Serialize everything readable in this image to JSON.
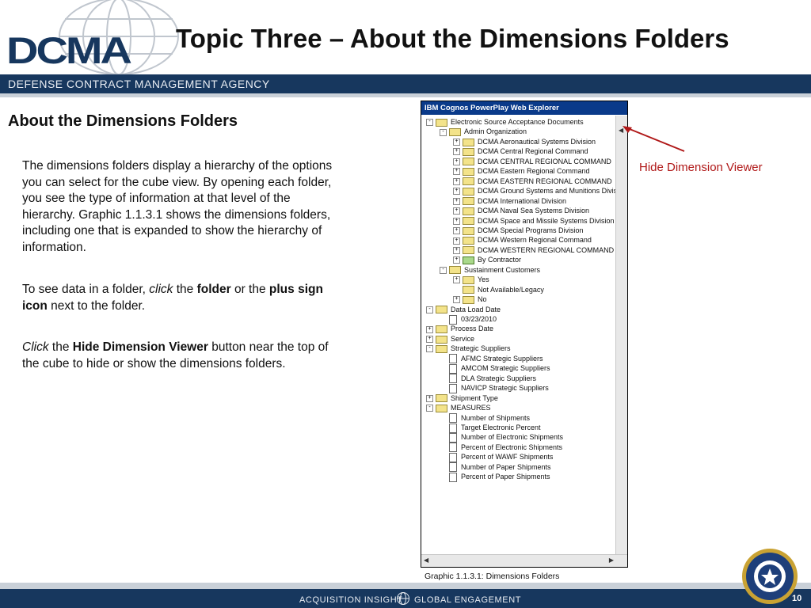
{
  "logo": {
    "text": "DCMA"
  },
  "title": "Topic Three – About the Dimensions Folders",
  "agency": "DEFENSE CONTRACT MANAGEMENT AGENCY",
  "subtitle": "About the Dimensions Folders",
  "para1": "The dimensions folders display a hierarchy of the options you can select for the cube view. By opening each folder, you see the type of information at that level of the hierarchy. Graphic 1.1.3.1 shows the dimensions folders, including one that is expanded to show the hierarchy of information.",
  "para2": {
    "a": "To see data in a folder, ",
    "b": "click",
    "c": " the ",
    "d": "folder",
    "e": " or the ",
    "f": "plus sign icon",
    "g": " next to the folder."
  },
  "para3": {
    "a": "Click",
    "b": " the ",
    "c": "Hide Dimension Viewer",
    "d": " button near the top of the cube to hide or show the dimensions folders."
  },
  "screenshot": {
    "title": "IBM Cognos PowerPlay Web Explorer",
    "tree": [
      {
        "label": "Electronic Source Acceptance Documents",
        "level": 0,
        "expander": "-",
        "icon": "folder"
      },
      {
        "label": "Admin Organization",
        "level": 1,
        "expander": "-",
        "icon": "folder"
      },
      {
        "label": "DCMA Aeronautical Systems Division",
        "level": 2,
        "expander": "+",
        "icon": "folder"
      },
      {
        "label": "DCMA Central Regional Command",
        "level": 2,
        "expander": "+",
        "icon": "folder"
      },
      {
        "label": "DCMA CENTRAL REGIONAL COMMAND",
        "level": 2,
        "expander": "+",
        "icon": "folder"
      },
      {
        "label": "DCMA Eastern Regional Command",
        "level": 2,
        "expander": "+",
        "icon": "folder"
      },
      {
        "label": "DCMA EASTERN REGIONAL COMMAND",
        "level": 2,
        "expander": "+",
        "icon": "folder"
      },
      {
        "label": "DCMA Ground Systems and Munitions Divis",
        "level": 2,
        "expander": "+",
        "icon": "folder"
      },
      {
        "label": "DCMA International Division",
        "level": 2,
        "expander": "+",
        "icon": "folder"
      },
      {
        "label": "DCMA Naval Sea Systems Division",
        "level": 2,
        "expander": "+",
        "icon": "folder"
      },
      {
        "label": "DCMA Space and Missile Systems Division",
        "level": 2,
        "expander": "+",
        "icon": "folder"
      },
      {
        "label": "DCMA Special Programs Division",
        "level": 2,
        "expander": "+",
        "icon": "folder"
      },
      {
        "label": "DCMA Western Regional Command",
        "level": 2,
        "expander": "+",
        "icon": "folder"
      },
      {
        "label": "DCMA WESTERN REGIONAL COMMAND",
        "level": 2,
        "expander": "+",
        "icon": "folder"
      },
      {
        "label": "By Contractor",
        "level": 2,
        "expander": "+",
        "icon": "folder-green"
      },
      {
        "label": "Sustainment Customers",
        "level": 1,
        "expander": "-",
        "icon": "folder"
      },
      {
        "label": "Yes",
        "level": 2,
        "expander": "+",
        "icon": "folder"
      },
      {
        "label": "Not Available/Legacy",
        "level": 2,
        "expander": "",
        "icon": "folder"
      },
      {
        "label": "No",
        "level": 2,
        "expander": "+",
        "icon": "folder"
      },
      {
        "label": "Data Load Date",
        "level": 0,
        "expander": "-",
        "icon": "folder"
      },
      {
        "label": "03/23/2010",
        "level": 1,
        "expander": "",
        "icon": "page"
      },
      {
        "label": "Process Date",
        "level": 0,
        "expander": "+",
        "icon": "folder"
      },
      {
        "label": "Service",
        "level": 0,
        "expander": "+",
        "icon": "folder"
      },
      {
        "label": "Strategic Suppliers",
        "level": 0,
        "expander": "-",
        "icon": "folder"
      },
      {
        "label": "AFMC Strategic Suppliers",
        "level": 1,
        "expander": "",
        "icon": "page"
      },
      {
        "label": "AMCOM Strategic Suppliers",
        "level": 1,
        "expander": "",
        "icon": "page"
      },
      {
        "label": "DLA Strategic Suppliers",
        "level": 1,
        "expander": "",
        "icon": "page"
      },
      {
        "label": "NAVICP Strategic Suppliers",
        "level": 1,
        "expander": "",
        "icon": "page"
      },
      {
        "label": "Shipment Type",
        "level": 0,
        "expander": "+",
        "icon": "folder"
      },
      {
        "label": "MEASURES",
        "level": 0,
        "expander": "-",
        "icon": "folder"
      },
      {
        "label": "Number of Shipments",
        "level": 1,
        "expander": "",
        "icon": "page"
      },
      {
        "label": "Target Electronic Percent",
        "level": 1,
        "expander": "",
        "icon": "page"
      },
      {
        "label": "Number of Electronic Shipments",
        "level": 1,
        "expander": "",
        "icon": "page"
      },
      {
        "label": "Percent of Electronic Shipments",
        "level": 1,
        "expander": "",
        "icon": "page"
      },
      {
        "label": "Percent of WAWF Shipments",
        "level": 1,
        "expander": "",
        "icon": "page"
      },
      {
        "label": "Number of Paper Shipments",
        "level": 1,
        "expander": "",
        "icon": "page"
      },
      {
        "label": "Percent of Paper Shipments",
        "level": 1,
        "expander": "",
        "icon": "page"
      }
    ]
  },
  "caption": "Graphic 1.1.3.1: Dimensions Folders",
  "callout": "Hide Dimension Viewer",
  "footer": {
    "left": "ACQUISITION INSIGHT",
    "right": "GLOBAL ENGAGEMENT",
    "page": "10"
  },
  "colors": {
    "navy": "#17375e",
    "callout_red": "#b01818",
    "window_title": "#0a3a8a"
  }
}
